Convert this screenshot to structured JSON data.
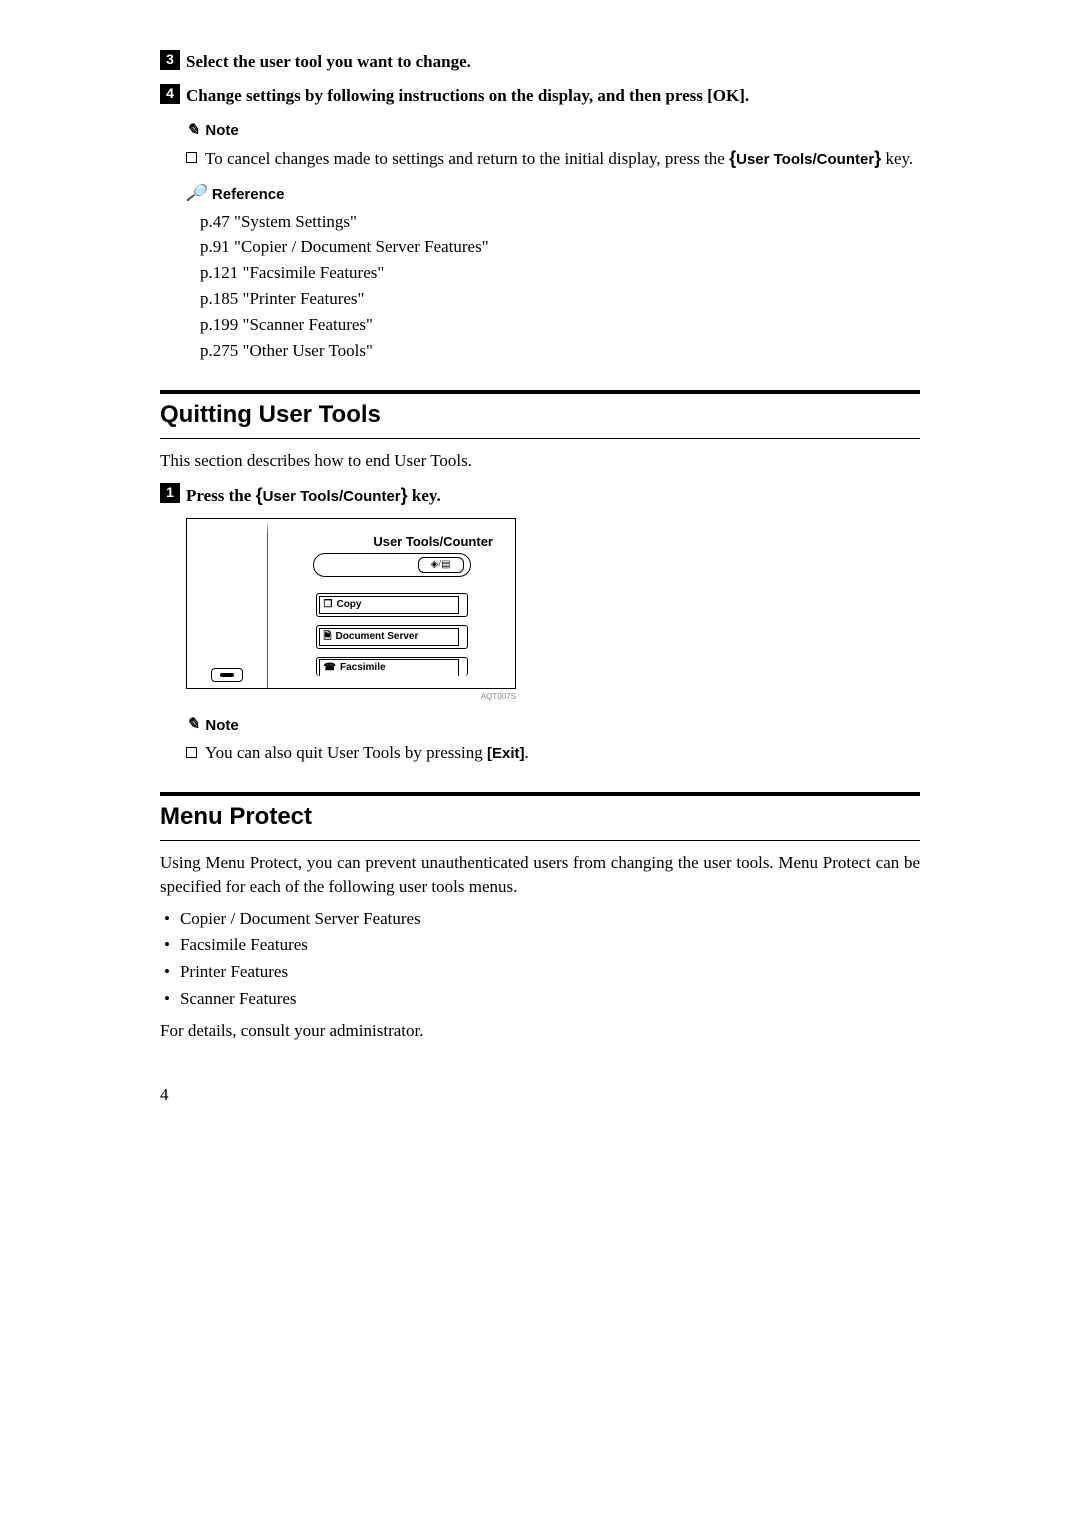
{
  "steps34": {
    "s3": "Select the user tool you want to change.",
    "s4": "Change settings by following instructions on the display, and then press [OK]."
  },
  "note1": {
    "heading": "Note",
    "text_a": "To cancel changes made to settings and return to the initial display, press the ",
    "key": "User Tools/Counter",
    "text_b": " key."
  },
  "reference": {
    "heading": "Reference",
    "items": [
      "p.47 \"System Settings\"",
      "p.91 \"Copier / Document Server Features\"",
      "p.121 \"Facsimile Features\"",
      "p.185 \"Printer Features\"",
      "p.199 \"Scanner Features\"",
      "p.275 \"Other User Tools\""
    ]
  },
  "quitting": {
    "heading": "Quitting User Tools",
    "intro": "This section describes how to end User Tools.",
    "step1_a": "Press the ",
    "step1_key": "User Tools/Counter",
    "step1_b": " key."
  },
  "panel": {
    "label": "User Tools/Counter",
    "btn_inner": "◈/▤",
    "copy": "Copy",
    "docserver": "Document Server",
    "fax": "Facsimile",
    "code": "AQT007S"
  },
  "note2": {
    "heading": "Note",
    "text_a": "You can also quit User Tools by pressing ",
    "bold": "[Exit]",
    "text_b": "."
  },
  "menu": {
    "heading": "Menu Protect",
    "body": "Using Menu Protect, you can prevent unauthenticated users from changing the user tools. Menu Protect can be specified for each of the following user tools menus.",
    "items": [
      "Copier / Document Server Features",
      "Facsimile Features",
      "Printer Features",
      "Scanner Features"
    ],
    "footer": "For details, consult your administrator."
  },
  "page": "4"
}
